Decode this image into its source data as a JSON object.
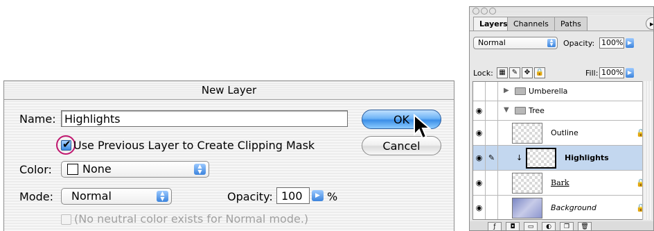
{
  "dialog": {
    "title": "New Layer",
    "name_label": "Name:",
    "name_value": "Highlights",
    "clipping_label": "Use Previous Layer to Create Clipping Mask",
    "clipping_checked": true,
    "color_label": "Color:",
    "color_value": "None",
    "mode_label": "Mode:",
    "mode_value": "Normal",
    "opacity_label": "Opacity:",
    "opacity_value": "100",
    "opacity_unit": "%",
    "neutral_label": "(No neutral color exists for Normal mode.)",
    "ok_label": "OK",
    "cancel_label": "Cancel",
    "accent_color": "#3c8fe8",
    "annotation_color": "#c0166e"
  },
  "palette": {
    "tabs": [
      "Layers",
      "Channels",
      "Paths"
    ],
    "active_tab": "Layers",
    "blend_mode": "Normal",
    "opacity_label": "Opacity:",
    "opacity_value": "100%",
    "lock_label": "Lock:",
    "fill_label": "Fill:",
    "fill_value": "100%",
    "layers": [
      {
        "name": "Umberella",
        "type": "group",
        "expanded": false,
        "visible": false
      },
      {
        "name": "Tree",
        "type": "group",
        "expanded": true,
        "visible": true
      },
      {
        "name": "Outline",
        "type": "layer",
        "visible": true,
        "locked": true
      },
      {
        "name": "Highlights",
        "type": "layer",
        "visible": true,
        "selected": true,
        "clipped": true
      },
      {
        "name": "Bark",
        "type": "layer",
        "visible": true,
        "locked": true
      },
      {
        "name": "Background",
        "type": "layer",
        "visible": true,
        "locked": true
      }
    ],
    "selection_color": "#c3d7ef"
  }
}
